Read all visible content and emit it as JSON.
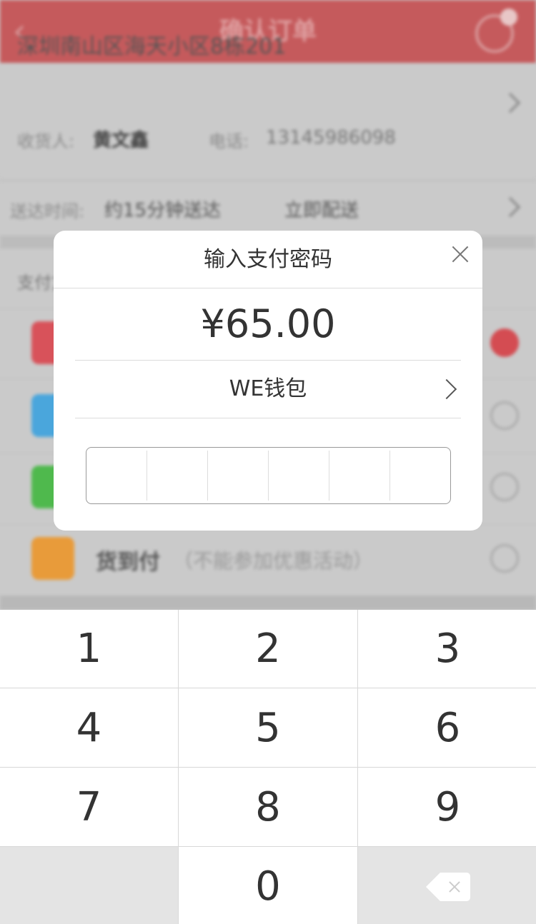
{
  "background_page": {
    "nav_title": "确认订单",
    "address_line": "深圳南山区海天小区8栋201",
    "consignee_label": "收货人:",
    "consignee_name": "黄文鑫",
    "phone_label": "电话:",
    "phone": "13145986098",
    "delivery_label": "送达时间:",
    "delivery_time": "约15分钟送达",
    "delivery_mode": "立即配送",
    "payment_section_label": "支付方式",
    "cod_name": "货到付",
    "cod_note": "（不能参加优惠活动）",
    "colors": {
      "nav_bg": "#c55a5c",
      "check_on": "#d44c52",
      "alipay": "#4aa6dc",
      "wechat": "#4fb94d",
      "cod": "#e89b3a",
      "wallet": "#d8525a"
    }
  },
  "modal": {
    "title": "输入支付密码",
    "amount": "¥65.00",
    "payment_method": "WE钱包",
    "password_length": 6
  },
  "keypad": {
    "keys": [
      "1",
      "2",
      "3",
      "4",
      "5",
      "6",
      "7",
      "8",
      "9",
      "",
      "0",
      "delete"
    ]
  }
}
